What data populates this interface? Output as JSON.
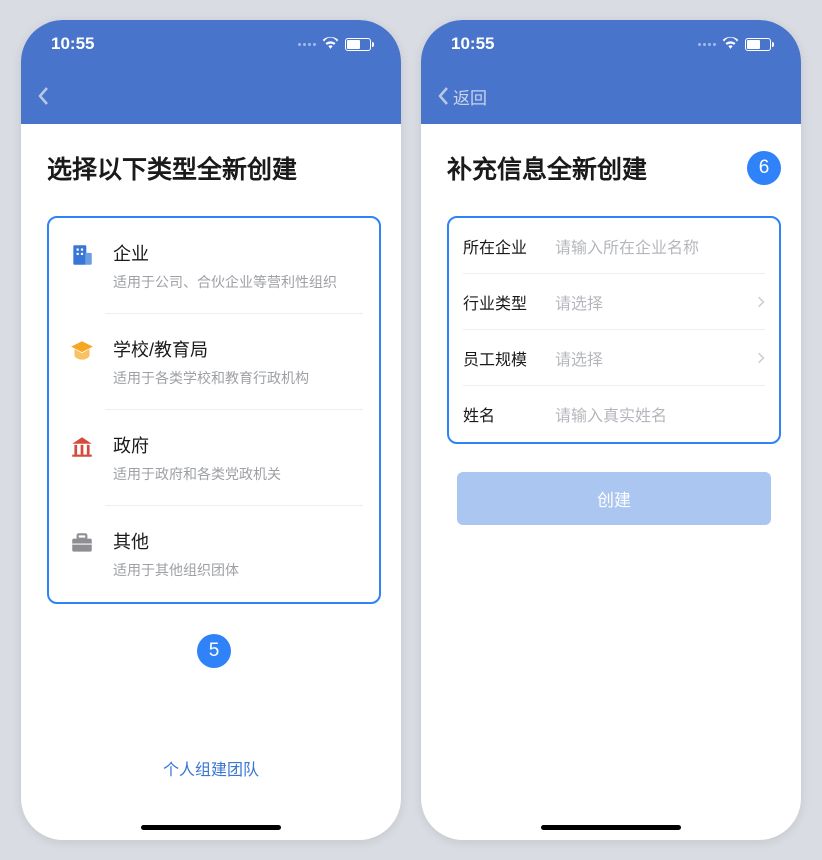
{
  "status": {
    "time": "10:55"
  },
  "screen1": {
    "title": "选择以下类型全新创建",
    "step": "5",
    "types": [
      {
        "name": "企业",
        "desc": "适用于公司、合伙企业等营利性组织"
      },
      {
        "name": "学校/教育局",
        "desc": "适用于各类学校和教育行政机构"
      },
      {
        "name": "政府",
        "desc": "适用于政府和各类党政机关"
      },
      {
        "name": "其他",
        "desc": "适用于其他组织团体"
      }
    ],
    "bottom_link": "个人组建团队"
  },
  "screen2": {
    "back_label": "返回",
    "title": "补充信息全新创建",
    "step": "6",
    "form": [
      {
        "label": "所在企业",
        "placeholder": "请输入所在企业名称",
        "chevron": false
      },
      {
        "label": "行业类型",
        "placeholder": "请选择",
        "chevron": true
      },
      {
        "label": "员工规模",
        "placeholder": "请选择",
        "chevron": true
      },
      {
        "label": "姓名",
        "placeholder": "请输入真实姓名",
        "chevron": false
      }
    ],
    "create_btn": "创建"
  }
}
